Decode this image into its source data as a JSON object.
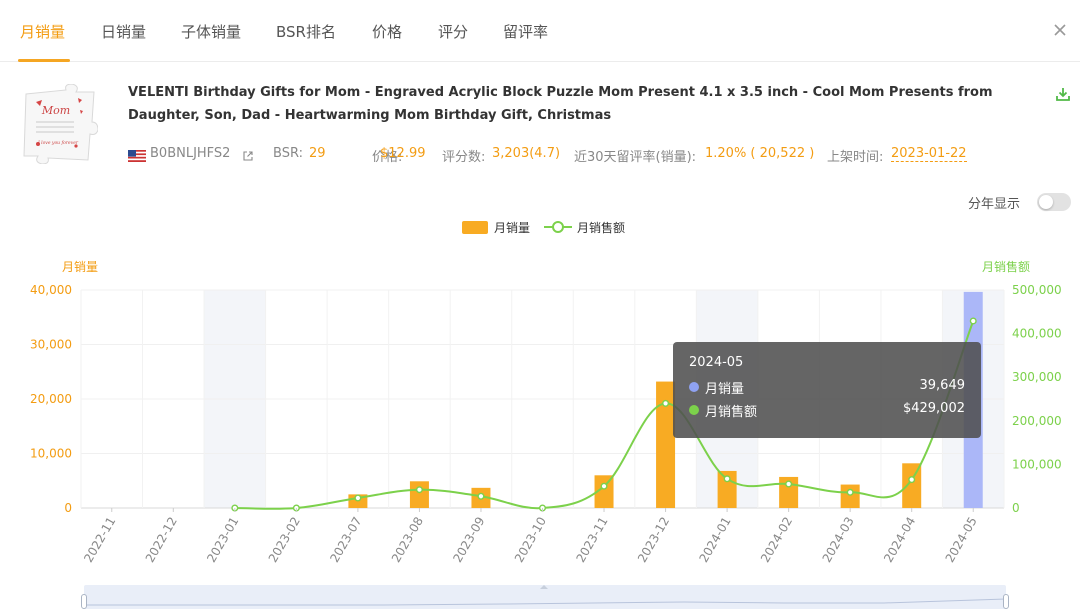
{
  "tabs": [
    {
      "label": "月销量",
      "active": true
    },
    {
      "label": "日销量"
    },
    {
      "label": "子体销量"
    },
    {
      "label": "BSR排名"
    },
    {
      "label": "价格"
    },
    {
      "label": "评分"
    },
    {
      "label": "留评率"
    }
  ],
  "product": {
    "title": "VELENTI Birthday Gifts for Mom - Engraved Acrylic Block Puzzle Mom Present 4.1 x 3.5 inch - Cool Mom Presents from Daughter, Son, Dad - Heartwarming Mom Birthday Gift, Christmas",
    "asin": "B0BNLJHFS2",
    "bsr_label": "BSR:",
    "bsr_value": "29",
    "price_label": "价格:",
    "price_value": "$12.99",
    "ratings_label": "评分数:",
    "ratings_value": "3,203(4.7)",
    "review_rate_label": "近30天留评率(销量):",
    "review_rate_value": "1.20% ( 20,522 )",
    "listed_label": "上架时间:",
    "listed_value": "2023-01-22",
    "thumbnail": {
      "text_top": "Mom",
      "text_bottom": "I love you forever"
    }
  },
  "controls": {
    "year_display_label": "分年显示",
    "year_display_on": false
  },
  "legend": [
    {
      "name": "月销量",
      "color": "#f8ab23",
      "type": "bar"
    },
    {
      "name": "月销售额",
      "color": "#7cd14b",
      "type": "line"
    }
  ],
  "tooltip": {
    "title": "2024-05",
    "rows": [
      {
        "label": "月销量",
        "value": "39,649",
        "color": "#8fa2f2"
      },
      {
        "label": "月销售额",
        "value": "$429,002",
        "color": "#7cd14b"
      }
    ]
  },
  "colors": {
    "accent": "#f39c12",
    "bar": "#f8ab23",
    "bar_highlight": "#abb7f8",
    "line": "#7cd14b",
    "shaded_band": "#f3f5f9"
  },
  "chart_data": {
    "type": "bar",
    "categories": [
      "2022-11",
      "2022-12",
      "2023-01",
      "2023-02",
      "2023-07",
      "2023-08",
      "2023-09",
      "2023-10",
      "2023-11",
      "2023-12",
      "2024-01",
      "2024-02",
      "2024-03",
      "2024-04",
      "2024-05"
    ],
    "series": [
      {
        "name": "月销量",
        "type": "bar",
        "axis": "left",
        "values": [
          null,
          null,
          0,
          0,
          2500,
          4900,
          3700,
          0,
          6000,
          23200,
          6800,
          5700,
          4300,
          8200,
          39649
        ]
      },
      {
        "name": "月销售额",
        "type": "line",
        "axis": "right",
        "values": [
          null,
          null,
          0,
          0,
          23000,
          42000,
          27000,
          0,
          50000,
          240000,
          67000,
          55000,
          36000,
          65000,
          429002
        ]
      }
    ],
    "y_left": {
      "label": "月销量",
      "ylim": [
        0,
        40000
      ],
      "ticks": [
        "0",
        "10,000",
        "20,000",
        "30,000",
        "40,000"
      ]
    },
    "y_right": {
      "label": "月销售额",
      "ylim": [
        0,
        500000
      ],
      "ticks": [
        "0",
        "100,000",
        "200,000",
        "300,000",
        "400,000",
        "500,000"
      ]
    },
    "highlighted_category": "2024-05",
    "shaded_categories": [
      "2023-01",
      "2024-01",
      "2024-05"
    ],
    "smooth_line": true,
    "grid": true
  }
}
